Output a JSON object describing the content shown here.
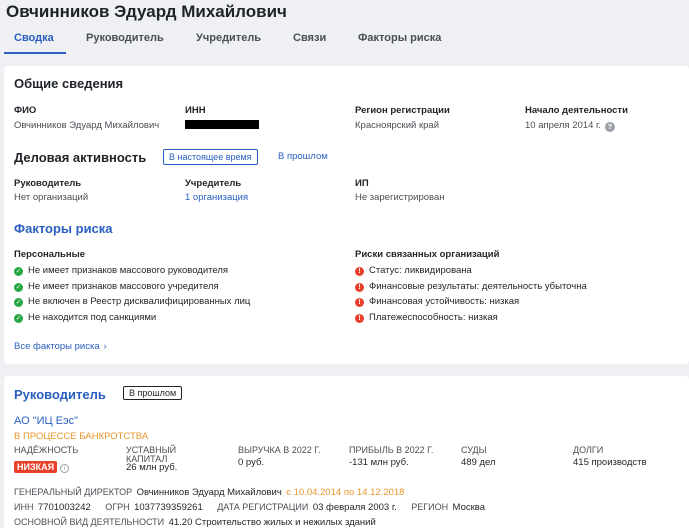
{
  "header": {
    "title": "Овчинников Эдуард Михайлович"
  },
  "tabs": [
    {
      "label": "Сводка"
    },
    {
      "label": "Руководитель"
    },
    {
      "label": "Учредитель"
    },
    {
      "label": "Связи"
    },
    {
      "label": "Факторы риска"
    }
  ],
  "general": {
    "heading": "Общие сведения",
    "fio_label": "ФИО",
    "fio_value": "Овчинников Эдуард Михайлович",
    "inn_label": "ИНН",
    "region_label": "Регион регистрации",
    "region_value": "Красноярский край",
    "start_label": "Начало деятельности",
    "start_value": "10 апреля 2014 г.",
    "help_glyph": "?"
  },
  "business": {
    "heading": "Деловая активность",
    "now_button": "В настоящее время",
    "past_link": "В прошлом",
    "manager_label": "Руководитель",
    "manager_value": "Нет организаций",
    "founder_label": "Учредитель",
    "founder_value": "1 организация",
    "ip_label": "ИП",
    "ip_value": "Не зарегистрирован"
  },
  "risks": {
    "heading": "Факторы риска",
    "personal_label": "Персональные",
    "personal_items": [
      "Не имеет признаков массового руководителя",
      "Не имеет признаков массового учредителя",
      "Не включен в Реестр дисквалифицированных лиц",
      "Не находится под санкциями"
    ],
    "related_label": "Риски связанных организаций",
    "related_items": [
      "Статус: ликвидирована",
      "Финансовые результаты: деятельность убыточна",
      "Финансовая устойчивость: низкая",
      "Платежеспособность: низкая"
    ],
    "all_link": "Все факторы риска",
    "ok_glyph": "✓",
    "warn_glyph": "!",
    "chevron_glyph": "›"
  },
  "manager_section": {
    "heading": "Руководитель",
    "past_button": "В прошлом",
    "company_name": "АО \"ИЦ Еэс\"",
    "company_status": "В ПРОЦЕССЕ БАНКРОТСТВА",
    "reliability_label": "НАДЁЖНОСТЬ",
    "reliability_value": "НИЗКАЯ",
    "capital_label_1": "УСТАВНЫЙ",
    "capital_label_2": "КАПИТАЛ",
    "capital_value": "26 млн руб.",
    "revenue_label": "ВЫРУЧКА В 2022 Г.",
    "revenue_value": "0 руб.",
    "profit_label": "ПРИБЫЛЬ В 2022 Г.",
    "profit_value": "-131 млн руб.",
    "courts_label": "СУДЫ",
    "courts_value": "489 дел",
    "debts_label": "ДОЛГИ",
    "debts_value": "415 производств",
    "director_label": "ГЕНЕРАЛЬНЫЙ ДИРЕКТОР",
    "director_value": "Овчинников Эдуард Михайлович",
    "director_period": "с 10.04.2014 по 14.12.2018",
    "inn_label": "ИНН",
    "inn_value": "7701003242",
    "ogrn_label": "ОГРН",
    "ogrn_value": "1037739359261",
    "regdate_label": "ДАТА РЕГИСТРАЦИИ",
    "regdate_value": "03 февраля 2003 г.",
    "region_label": "РЕГИОН",
    "region_value": "Москва",
    "activity_label": "ОСНОВНОЙ ВИД ДЕЯТЕЛЬНОСТИ",
    "activity_value": "41.20 Строительство жилых и нежилых зданий",
    "info_glyph": "i"
  }
}
